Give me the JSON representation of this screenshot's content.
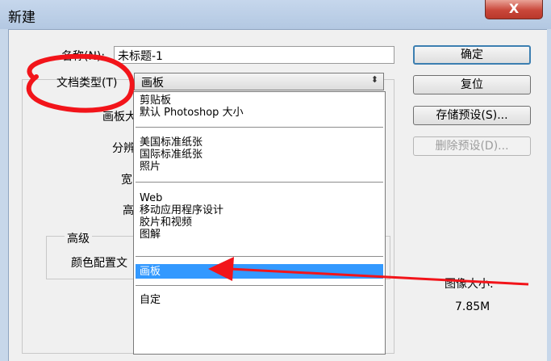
{
  "window": {
    "title": "新建",
    "close_label": "X"
  },
  "form": {
    "name_label": "名称(N):",
    "name_value": "未标题-1",
    "doctype_label": "文档类型(T)",
    "doctype_value": "画板",
    "board_label": "画板大",
    "resolution_label": "分辨",
    "width_label": "宽",
    "height_label": "高",
    "advanced_label": "高级",
    "color_profile_label": "颜色配置文",
    "image_size_label": "图像大小:",
    "image_size_value": "7.85M"
  },
  "buttons": {
    "ok": "确定",
    "reset": "复位",
    "save_preset": "存储预设(S)...",
    "delete_preset": "删除预设(D)..."
  },
  "dropdown": {
    "items": [
      "剪贴板",
      "默认 Photoshop 大小",
      "美国标准纸张",
      "国际标准纸张",
      "照片",
      "Web",
      "移动应用程序设计",
      "胶片和视频",
      "图解",
      "画板",
      "自定"
    ],
    "selected": "画板"
  }
}
